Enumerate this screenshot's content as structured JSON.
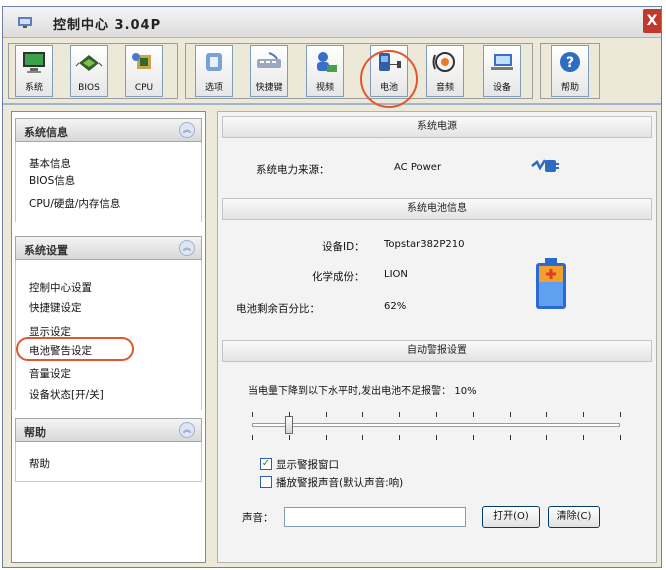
{
  "window": {
    "title": "控制中心 3.04P",
    "close_glyph": "X"
  },
  "toolbar": {
    "buttons": [
      {
        "label": "系统",
        "icon": "monitor-icon"
      },
      {
        "label": "BIOS",
        "icon": "chip-icon"
      },
      {
        "label": "CPU",
        "icon": "cpu-icon"
      },
      {
        "label": "选项",
        "icon": "settings-icon"
      },
      {
        "label": "快捷键",
        "icon": "keyboard-icon"
      },
      {
        "label": "视频",
        "icon": "display-user-icon"
      },
      {
        "label": "电池",
        "icon": "battery-plug-icon"
      },
      {
        "label": "音频",
        "icon": "audio-icon"
      },
      {
        "label": "设备",
        "icon": "device-icon"
      },
      {
        "label": "帮助",
        "icon": "help-icon"
      }
    ]
  },
  "sidebar": {
    "sections": [
      {
        "title": "系统信息",
        "items": [
          "基本信息",
          "BIOS信息",
          "CPU/硬盘/内存信息"
        ]
      },
      {
        "title": "系统设置",
        "items": [
          "控制中心设置",
          "快捷键设定",
          "显示设定",
          "电池警告设定",
          "音量设定",
          "设备状态[开/关]"
        ]
      },
      {
        "title": "帮助",
        "items": [
          "帮助"
        ]
      }
    ]
  },
  "main": {
    "power_source": {
      "header": "系统电源",
      "label": "系统电力来源：",
      "value": "AC Power"
    },
    "battery": {
      "header": "系统电池信息",
      "device_id_label": "设备ID：",
      "device_id": "Topstar382P210",
      "chemistry_label": "化学成份：",
      "chemistry": "LION",
      "remaining_label": "电池剩余百分比：",
      "remaining": "62%"
    },
    "alarm": {
      "header": "自动警报设置",
      "threshold_text": "当电量下降到以下水平时,发出电池不足报警： 10%",
      "threshold_percent": 10,
      "show_window_label": "显示警报窗口",
      "show_window_checked": true,
      "play_sound_label": "播放警报声音(默认声音:响)",
      "play_sound_checked": false,
      "sound_label": "声音：",
      "sound_value": "",
      "open_button": "打开(O)",
      "clear_button": "清除(C)"
    }
  },
  "colors": {
    "highlight": "#e0572e",
    "accent": "#2c5fa8"
  }
}
